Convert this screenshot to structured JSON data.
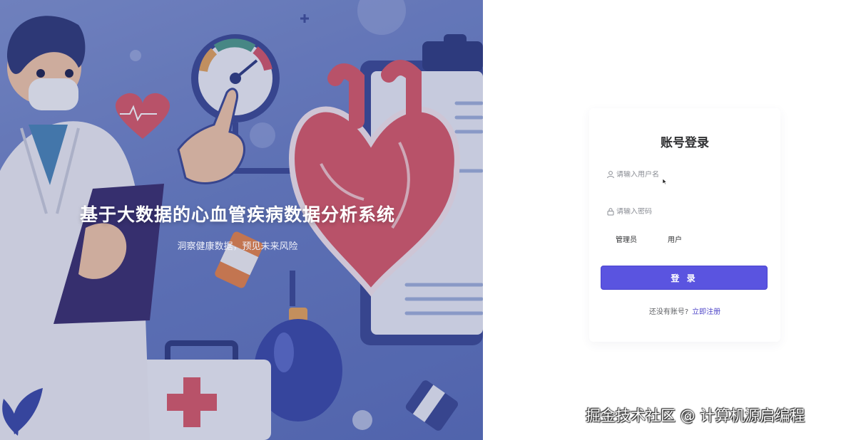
{
  "hero": {
    "title": "基于大数据的心血管疾病数据分析系统",
    "subtitle": "洞察健康数据，预见未来风险"
  },
  "login": {
    "title": "账号登录",
    "username_placeholder": "请输入用户名",
    "password_placeholder": "请输入密码",
    "roles": [
      "管理员",
      "用户"
    ],
    "submit_label": "登 录",
    "register_prompt": "还没有账号?",
    "register_link": "立即注册"
  },
  "watermark": "掘金技术社区 @ 计算机源启编程",
  "colors": {
    "accent": "#5a54e0",
    "link": "#4f46c8",
    "hero_bg": "#6a7fc4"
  },
  "icons": {
    "user": "user-icon",
    "lock": "lock-icon"
  }
}
